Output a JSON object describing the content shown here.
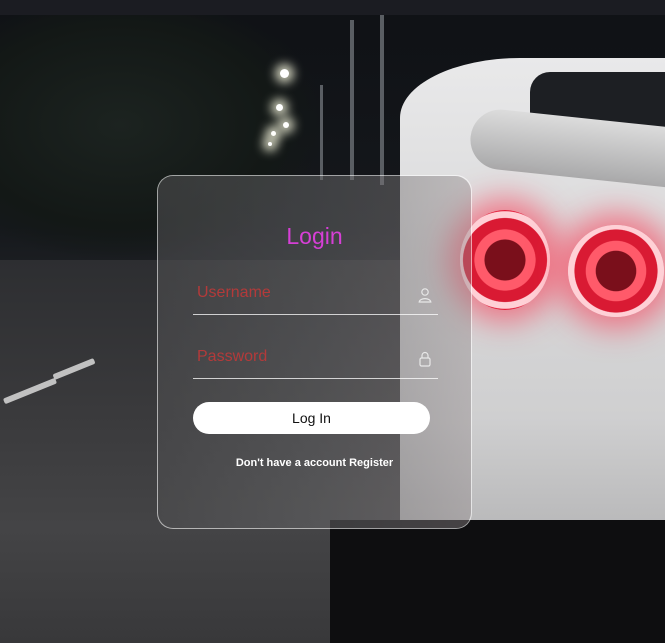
{
  "login": {
    "title": "Login",
    "username_placeholder": "Username",
    "password_placeholder": "Password",
    "login_button": "Log In",
    "register_prompt": "Don't have a account",
    "register_link": "Register"
  },
  "icons": {
    "username": "user-icon",
    "password": "lock-icon"
  },
  "colors": {
    "title": "#d63fd6",
    "placeholder": "#b33a3a",
    "button_bg": "#ffffff",
    "card_border": "#d9d9d9"
  }
}
